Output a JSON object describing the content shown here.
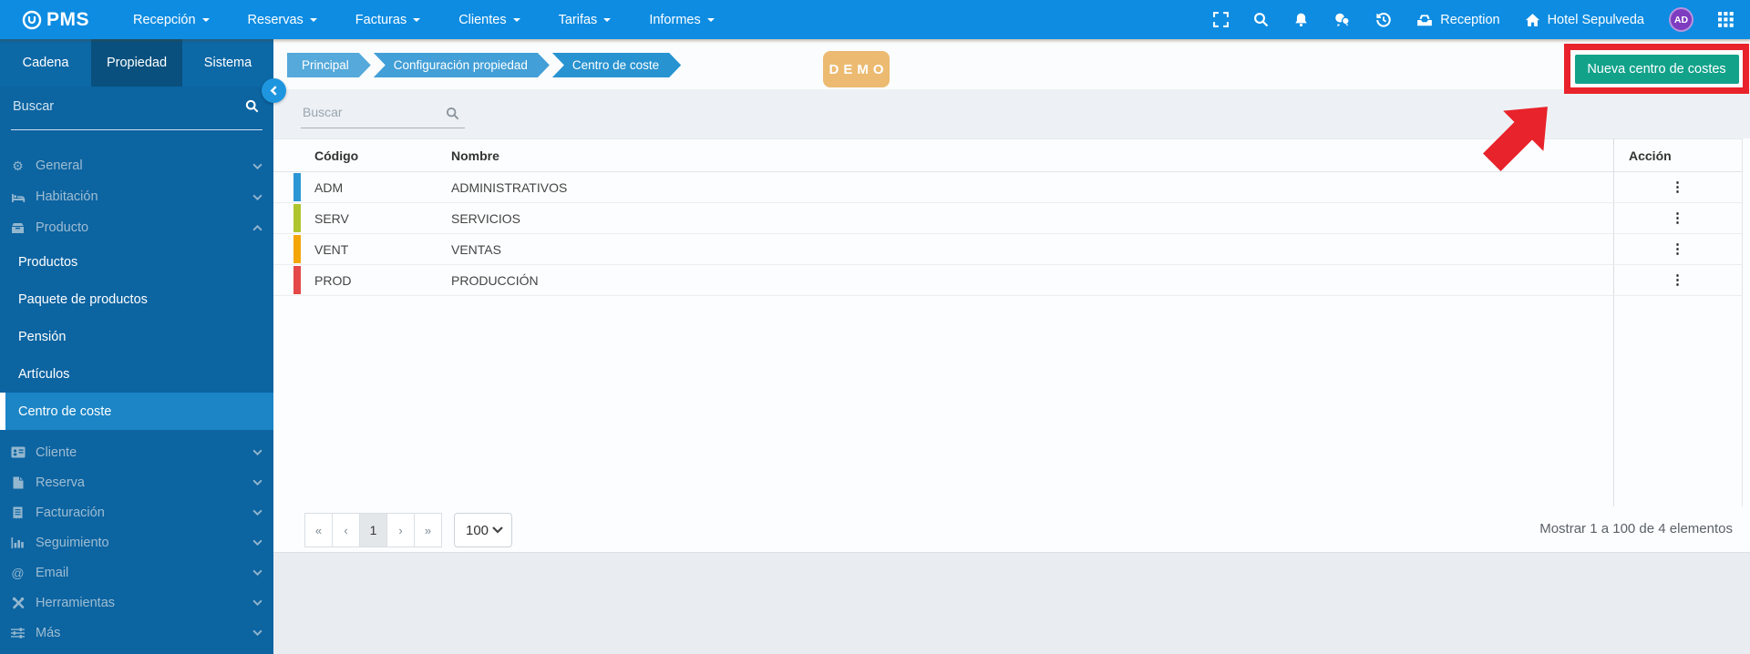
{
  "topnav": {
    "logo_text": "PMS",
    "menus": [
      {
        "label": "Recepción"
      },
      {
        "label": "Reservas"
      },
      {
        "label": "Facturas"
      },
      {
        "label": "Clientes"
      },
      {
        "label": "Tarifas"
      },
      {
        "label": "Informes"
      }
    ],
    "reception_label": "Reception",
    "hotel_label": "Hotel Sepulveda",
    "avatar_initials": "AD"
  },
  "sidebar": {
    "tabs": [
      {
        "label": "Cadena",
        "active": false
      },
      {
        "label": "Propiedad",
        "active": true
      },
      {
        "label": "Sistema",
        "active": false
      }
    ],
    "search_placeholder": "Buscar",
    "items": [
      {
        "label": "General",
        "icon": "gears"
      },
      {
        "label": "Habitación",
        "icon": "bed"
      },
      {
        "label": "Producto",
        "icon": "box",
        "expanded": true
      },
      {
        "label": "Cliente",
        "icon": "id-card"
      },
      {
        "label": "Reserva",
        "icon": "file"
      },
      {
        "label": "Facturación",
        "icon": "receipt"
      },
      {
        "label": "Seguimiento",
        "icon": "bar-chart"
      },
      {
        "label": "Email",
        "icon": "at-sign"
      },
      {
        "label": "Herramientas",
        "icon": "tools"
      },
      {
        "label": "Más",
        "icon": "sliders"
      }
    ],
    "producto_children": [
      {
        "label": "Productos",
        "active": false
      },
      {
        "label": "Paquete de productos",
        "active": false
      },
      {
        "label": "Pensión",
        "active": false
      },
      {
        "label": "Artículos",
        "active": false
      },
      {
        "label": "Centro de coste",
        "active": true
      }
    ]
  },
  "breadcrumb": [
    {
      "label": "Principal"
    },
    {
      "label": "Configuración propiedad"
    },
    {
      "label": "Centro de coste"
    }
  ],
  "demo_badge": "DEMO",
  "actions": {
    "new_button_label": "Nueva centro de costes"
  },
  "search": {
    "placeholder": "Buscar"
  },
  "table": {
    "columns": [
      "Código",
      "Nombre",
      "Acción"
    ],
    "rows": [
      {
        "codigo": "ADM",
        "nombre": "ADMINISTRATIVOS",
        "color": "#2b97d4"
      },
      {
        "codigo": "SERV",
        "nombre": "SERVICIOS",
        "color": "#afc52f"
      },
      {
        "codigo": "VENT",
        "nombre": "VENTAS",
        "color": "#f4a609"
      },
      {
        "codigo": "PROD",
        "nombre": "PRODUCCIÓN",
        "color": "#e54848"
      }
    ],
    "kebab_glyph": "⋮"
  },
  "pagination": {
    "first": "«",
    "prev": "‹",
    "page": "1",
    "next": "›",
    "last": "»",
    "page_size": "100",
    "summary": "Mostrar 1 a 100 de 4 elementos"
  },
  "colors": {
    "navbar_blue": "#0d8ce2",
    "sidebar_blue": "#0c64a1",
    "active_item_blue": "#1b85c6",
    "button_green": "#12a28a",
    "highlight_red": "#e8232b",
    "demo_orange": "#ecba70"
  }
}
